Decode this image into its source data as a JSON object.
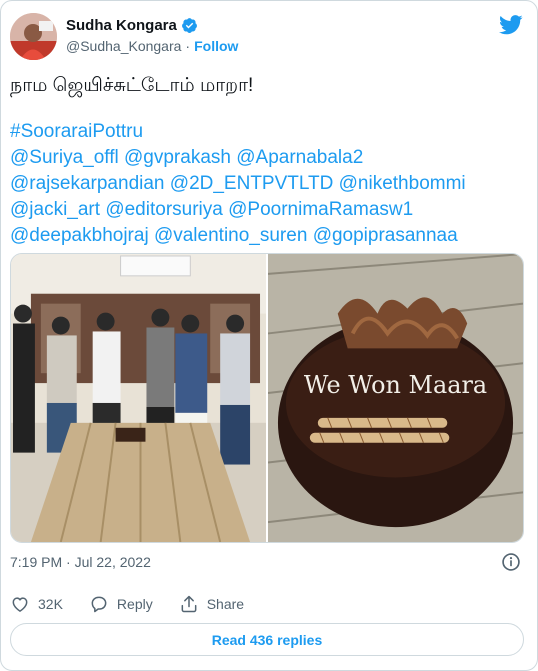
{
  "author": {
    "display_name": "Sudha Kongara",
    "handle": "@Sudha_Kongara",
    "separator": "·",
    "follow_label": "Follow"
  },
  "tweet": {
    "line1": "நாம ஜெயிச்சுட்டோம் மாறா!",
    "hashtag": "#SooraraiPottru",
    "mention_lines": [
      [
        "@Suriya_offl",
        "@gvprakash",
        "@Aparnabala2"
      ],
      [
        "@rajsekarpandian",
        "@2D_ENTPVTLTD",
        "@nikethbommi"
      ],
      [
        "@jacki_art",
        "@editorsuriya",
        "@PoornimaRamasw1"
      ],
      [
        "@deepakbhojraj",
        "@valentino_suren",
        "@gopiprasannaa"
      ]
    ]
  },
  "media": {
    "cake_text": "We Won Maara"
  },
  "meta": {
    "timestamp": "7:19 PM · Jul 22, 2022"
  },
  "actions": {
    "likes": "32K",
    "reply_label": "Reply",
    "share_label": "Share"
  },
  "read_replies_label": "Read 436 replies",
  "icons": {
    "verified": "verified-badge-icon",
    "brand": "twitter-bird-icon",
    "info": "info-icon",
    "like": "heart-icon",
    "reply": "reply-bubble-icon",
    "share": "share-icon"
  },
  "colors": {
    "link": "#1d9bf0",
    "text": "#0f1419",
    "muted": "#536471",
    "border": "#cfd9de"
  }
}
